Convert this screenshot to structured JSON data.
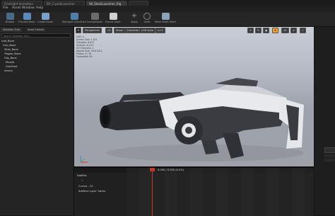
{
  "window": {
    "tabs": [
      "Flashlight Animation",
      "BP_CrystalLauncher",
      "SK_StockLauncher_Rig"
    ],
    "menu": [
      "File",
      "Asset",
      "Window",
      "Help"
    ]
  },
  "toolbar": {
    "buttons": [
      "Browse",
      "Preview Mesh",
      "Create Asset",
      "Reimport Animation",
      "Compression",
      "Export Asset",
      "Apply",
      "Undo",
      "Make Static Mesh"
    ]
  },
  "left_panel": {
    "tabs": [
      "Skeleton Tree",
      "Asset Details"
    ],
    "search_placeholder": "Search Skeleton Tree...",
    "bones": [
      "root_Bone",
      "Grip_Bone",
      "Slide_Bone",
      "Trigger_Bone",
      "Clip_Bone",
      "Muzzle",
      "GripPoint",
      "Ammo"
    ]
  },
  "viewport": {
    "buttons": [
      "Perspective",
      "Lit",
      "Show",
      "Character",
      "LOD Auto",
      "x1.0"
    ],
    "stats": [
      "LOD: 0",
      "Screen Size: 1.431",
      "Triangles: 8,612",
      "Vertices: 6,103",
      "UV Channels: 1",
      "Approx Size: 34x12x11",
      "Frame: 0 / 30",
      "Framerate: 60"
    ]
  },
  "timeline": {
    "rows": [
      "Notifies",
      "1",
      "Curves - 20",
      "Additive Layer Tracks"
    ],
    "time_readout": "0.000 / 0.000 (0.0%)"
  },
  "colors": {
    "accent": "#f1a12c",
    "bg_dark": "#151515",
    "panel": "#242424",
    "sky_top": "#c9cdd6",
    "floor": "#9ea1a8"
  }
}
